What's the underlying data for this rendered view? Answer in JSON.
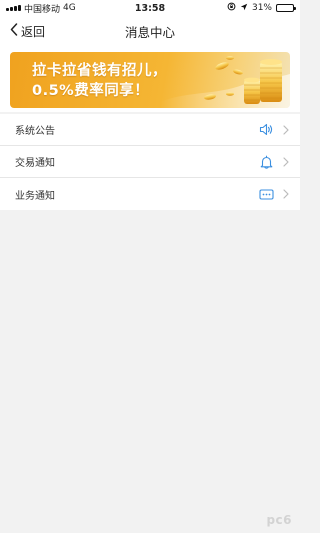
{
  "status_bar": {
    "carrier": "中国移动",
    "network": "4G",
    "time": "13:58",
    "battery": "31%",
    "battery_level": 0.31
  },
  "nav": {
    "back_label": "返回",
    "title": "消息中心"
  },
  "banner": {
    "line1": "拉卡拉省钱有招儿，",
    "line2": "0.5%费率同享！"
  },
  "list": {
    "items": [
      {
        "label": "系统公告",
        "icon": "speaker-icon"
      },
      {
        "label": "交易通知",
        "icon": "bell-icon"
      },
      {
        "label": "业务通知",
        "icon": "message-icon"
      }
    ]
  },
  "colors": {
    "accent": "#3b8fe0",
    "background": "#f2f2f2",
    "banner_orange": "#f0a21f"
  },
  "watermark": "pc6"
}
